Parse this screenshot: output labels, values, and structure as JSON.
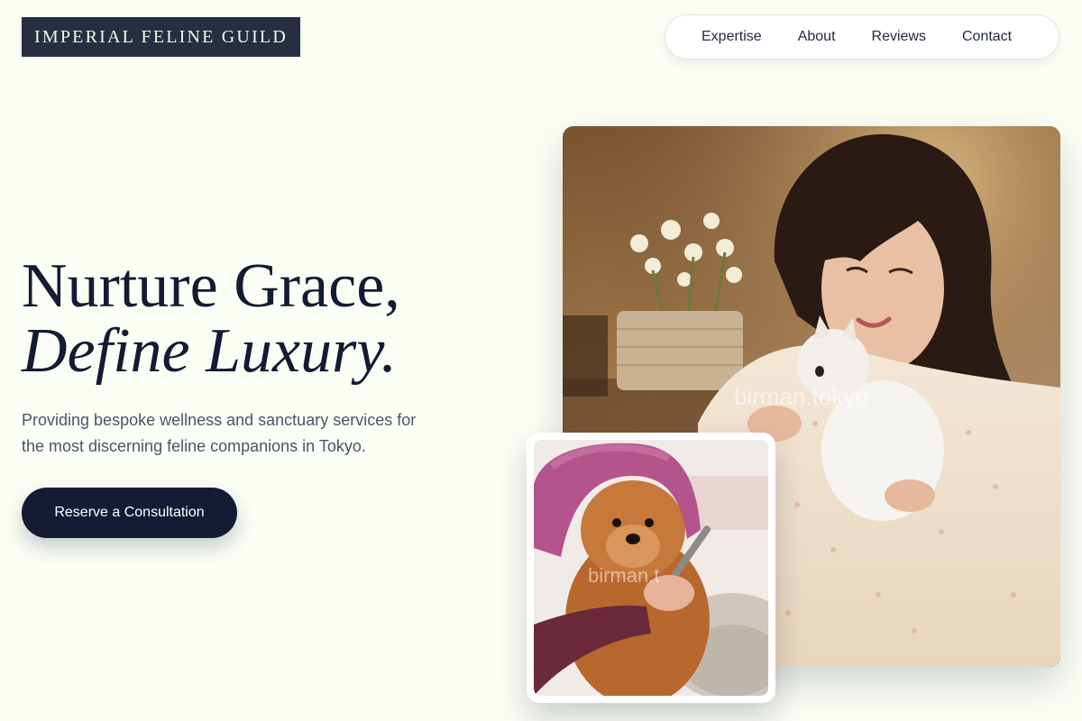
{
  "brand": {
    "logo_text": "IMPERIAL FELINE GUILD"
  },
  "nav": {
    "items": [
      {
        "label": "Expertise"
      },
      {
        "label": "About"
      },
      {
        "label": "Reviews"
      },
      {
        "label": "Contact"
      }
    ]
  },
  "hero": {
    "headline_line1": "Nurture Grace,",
    "headline_line2": "Define Luxury.",
    "subtitle": "Providing bespoke wellness and sanctuary services for the most discerning feline companions in Tokyo.",
    "cta_label": "Reserve a Consultation"
  },
  "images": {
    "main": {
      "watermark": "birman.tokyo"
    },
    "secondary": {
      "watermark": "birman.t"
    }
  },
  "colors": {
    "background": "#fbfef5",
    "logo_bg": "#272e41",
    "primary_dark": "#141b33",
    "muted_text": "#4b5568"
  }
}
